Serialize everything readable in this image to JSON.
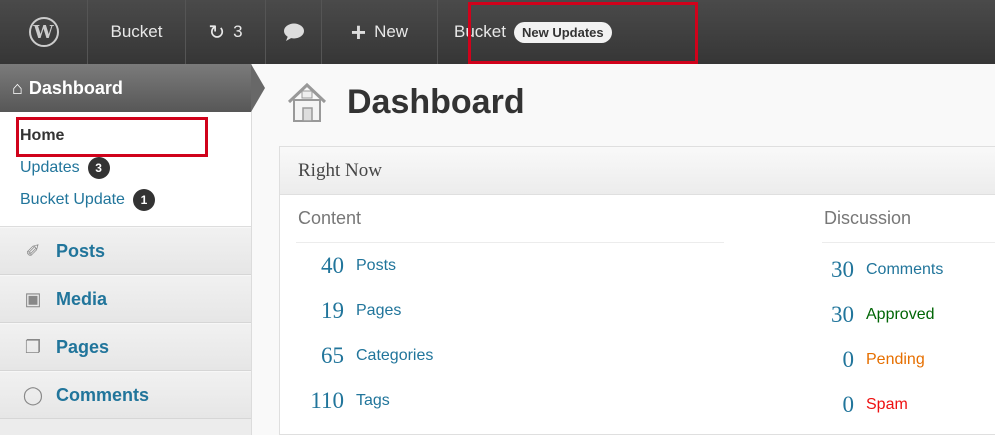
{
  "admin_bar": {
    "site_name": "Bucket",
    "updates_count": "3",
    "new_label": "New",
    "bucket_label": "Bucket",
    "bucket_badge": "New Updates"
  },
  "sidebar": {
    "dashboard_label": "Dashboard",
    "submenu": {
      "home": "Home",
      "updates": "Updates",
      "updates_count": "3",
      "bucket_update": "Bucket Update",
      "bucket_update_count": "1"
    },
    "items": [
      {
        "label": "Posts",
        "icon": "pushpin-icon"
      },
      {
        "label": "Media",
        "icon": "media-icon"
      },
      {
        "label": "Pages",
        "icon": "pages-icon"
      },
      {
        "label": "Comments",
        "icon": "comments-icon"
      }
    ]
  },
  "main": {
    "title": "Dashboard",
    "right_now": {
      "title": "Right Now",
      "content_heading": "Content",
      "discussion_heading": "Discussion",
      "content": [
        {
          "num": "40",
          "label": "Posts"
        },
        {
          "num": "19",
          "label": "Pages"
        },
        {
          "num": "65",
          "label": "Categories"
        },
        {
          "num": "110",
          "label": "Tags"
        }
      ],
      "discussion": [
        {
          "num": "30",
          "label": "Comments"
        },
        {
          "num": "30",
          "label": "Approved"
        },
        {
          "num": "0",
          "label": "Pending"
        },
        {
          "num": "0",
          "label": "Spam"
        }
      ]
    }
  },
  "colors": {
    "link": "#21759b",
    "approved": "#006505",
    "pending": "#e66f00",
    "spam": "#ee1111",
    "highlight": "#d0021b"
  }
}
